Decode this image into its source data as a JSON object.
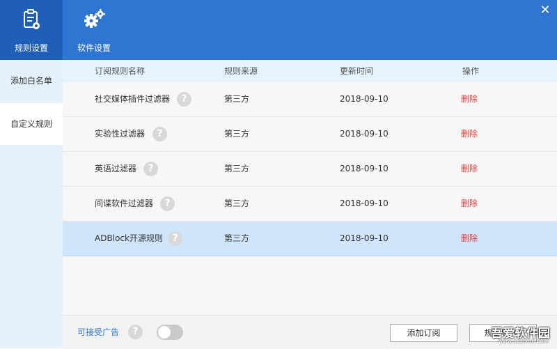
{
  "nav": {
    "tabs": [
      {
        "label": "规则设置",
        "icon": "clipboard-gear-icon",
        "active": true
      },
      {
        "label": "软件设置",
        "icon": "gears-icon",
        "active": false
      }
    ],
    "close_icon": "close-icon"
  },
  "sidebar": {
    "items": [
      {
        "label": "添加白名单"
      },
      {
        "label": "自定义规则"
      }
    ]
  },
  "table": {
    "headers": [
      "订阅规则名称",
      "规则来源",
      "更新时间",
      "操作"
    ],
    "rows": [
      {
        "name": "社交媒体插件过滤器",
        "source": "第三方",
        "date": "2018-09-10",
        "action": "删除"
      },
      {
        "name": "实验性过滤器",
        "source": "第三方",
        "date": "2018-09-10",
        "action": "删除"
      },
      {
        "name": "英语过滤器",
        "source": "第三方",
        "date": "2018-09-10",
        "action": "删除"
      },
      {
        "name": "间谍软件过滤器",
        "source": "第三方",
        "date": "2018-09-10",
        "action": "删除"
      },
      {
        "name": "ADBlock开源规则",
        "source": "第三方",
        "date": "2018-09-10",
        "action": "删除",
        "selected": true
      }
    ]
  },
  "footer": {
    "ad_label": "可接受广告",
    "ad_toggle_on": false,
    "add_button": "添加订阅",
    "import_button": "规则导入"
  },
  "watermark": {
    "text": "吾爱软件园",
    "url": "www.52zixue.com"
  },
  "colors": {
    "topbar": "#2f76d2",
    "active_tab": "#1f5fb8",
    "delete": "#e43b3b",
    "selected_row": "#cfe5fb"
  }
}
